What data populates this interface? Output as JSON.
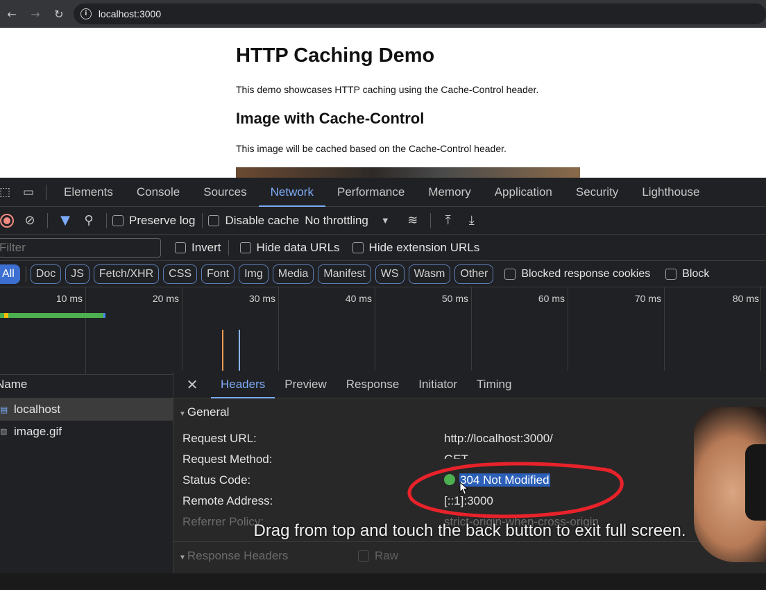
{
  "browser": {
    "back_icon": "arrow-left-icon",
    "forward_icon": "arrow-right-icon",
    "reload_icon": "reload-icon",
    "url": "localhost:3000"
  },
  "page": {
    "title": "HTTP Caching Demo",
    "intro": "This demo showcases HTTP caching using the Cache-Control header.",
    "section_title": "Image with Cache-Control",
    "section_text": "This image will be cached based on the Cache-Control header."
  },
  "devtools": {
    "tabs": [
      "Elements",
      "Console",
      "Sources",
      "Network",
      "Performance",
      "Memory",
      "Application",
      "Security",
      "Lighthouse"
    ],
    "active_tab": "Network",
    "toolbar": {
      "preserve_log": "Preserve log",
      "disable_cache": "Disable cache",
      "throttling": "No throttling"
    },
    "filter": {
      "placeholder": "Filter",
      "invert": "Invert",
      "hide_data_urls": "Hide data URLs",
      "hide_extension_urls": "Hide extension URLs"
    },
    "types": [
      "All",
      "Doc",
      "JS",
      "Fetch/XHR",
      "CSS",
      "Font",
      "Img",
      "Media",
      "Manifest",
      "WS",
      "Wasm",
      "Other"
    ],
    "blocked_cookies": "Blocked response cookies",
    "blocked_requests": "Block",
    "timeline_ticks": [
      "10 ms",
      "20 ms",
      "30 ms",
      "40 ms",
      "50 ms",
      "60 ms",
      "70 ms",
      "80 ms"
    ],
    "requests_header": "Name",
    "requests": [
      "localhost",
      "image.gif"
    ],
    "detail_tabs": [
      "Headers",
      "Preview",
      "Response",
      "Initiator",
      "Timing"
    ],
    "general_section": "General",
    "general": [
      {
        "key": "Request URL:",
        "value": "http://localhost:3000/"
      },
      {
        "key": "Request Method:",
        "value": "GET"
      },
      {
        "key": "Status Code:",
        "value": "304 Not Modified"
      },
      {
        "key": "Remote Address:",
        "value": "[::1]:3000"
      },
      {
        "key": "Referrer Policy:",
        "value": "strict-origin-when-cross-origin"
      }
    ],
    "response_section": "Response Headers",
    "raw_label": "Raw"
  },
  "overlay_message": "Drag from top and touch the back button to exit full screen.",
  "colors": {
    "accent": "#7cacf8",
    "status_ok": "#4caf50",
    "annotation": "#e8222a"
  }
}
